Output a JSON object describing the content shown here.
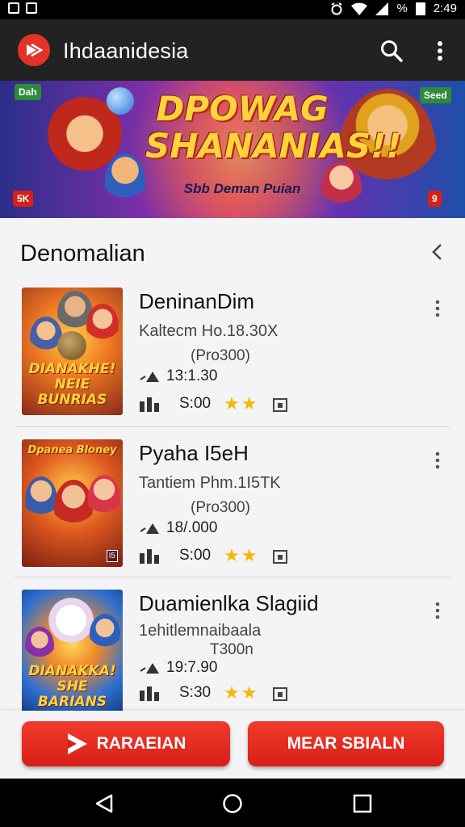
{
  "status_bar": {
    "battery_text": "%",
    "time": "2:49"
  },
  "app_bar": {
    "title": "Ihdaanidesia"
  },
  "banner": {
    "title": "DPOWAG SHANANIAS!!",
    "subtitle": "Sbb Deman Puian",
    "badge_top_left": "Dah",
    "badge_top_right": "Seed",
    "badge_bottom_left": "5K",
    "badge_bottom_right": "9",
    "colors": {
      "accent": "#ffd43a",
      "badge_red": "#d81f18",
      "badge_green": "#2e8b3a"
    }
  },
  "section": {
    "title": "Denomalian"
  },
  "games": [
    {
      "title": "DeninanDim",
      "desc": "Kaltecm Ho.18.30X",
      "price": "(Pro300)",
      "downloads": "13:1.30",
      "time": "S:00",
      "stars": "★★",
      "thumb_top": "",
      "thumb_label": "DIANAKHE! NEIE BUNRIAS",
      "thumb_badge": "",
      "thumb_bg": "#e0641c"
    },
    {
      "title": "Pyaha I5eH",
      "desc": "Tantiem Phm.1I5TK",
      "price": "(Pro300)",
      "downloads": "18/.000",
      "time": "S:00",
      "stars": "★★",
      "thumb_top": "Dpanea Bloney",
      "thumb_label": "",
      "thumb_badge": "I5",
      "thumb_bg": "#d8501f"
    },
    {
      "title": "Duamienlka Slagiid",
      "desc": "1ehitlemnaibaala",
      "price": "T300n",
      "downloads": "19:7.90",
      "time": "S:30",
      "stars": "★★",
      "thumb_top": "",
      "thumb_label": "DIANAKKA! SHE BARIANS",
      "thumb_badge": "",
      "thumb_bg": "#2e6fd0"
    }
  ],
  "buttons": {
    "left_label": "RARAEIAN",
    "right_label": "MEAR SBIALN"
  }
}
